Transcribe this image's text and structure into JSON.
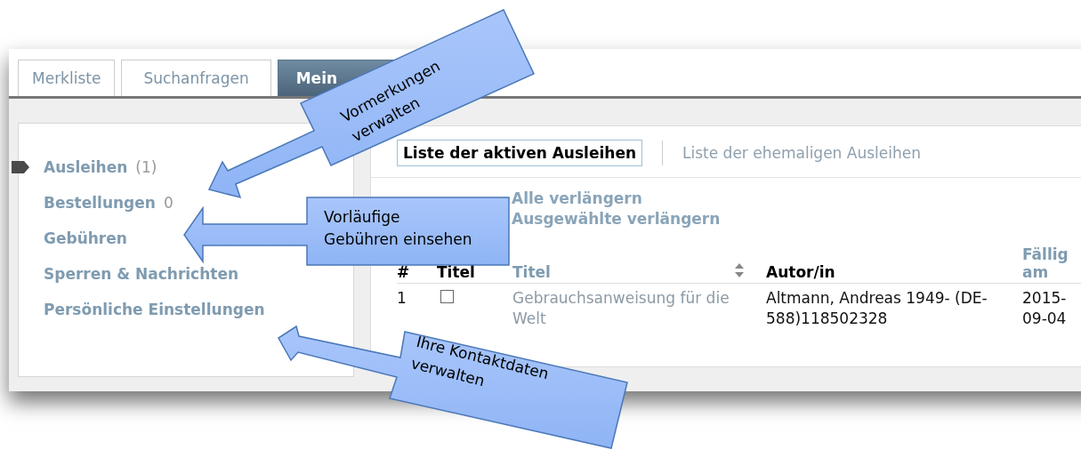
{
  "tabs": [
    {
      "label": "Merkliste",
      "selected": false
    },
    {
      "label": "Suchanfragen",
      "selected": false
    },
    {
      "label": "Mein",
      "selected": true
    }
  ],
  "sidebar": {
    "items": [
      {
        "label": "Ausleihen",
        "count": "(1)",
        "selected": true
      },
      {
        "label": "Bestellungen",
        "count": "0",
        "selected": false
      },
      {
        "label": "Gebühren",
        "selected": false
      },
      {
        "label": "Sperren & Nachrichten",
        "selected": false
      },
      {
        "label": "Persönliche Einstellungen",
        "selected": false
      }
    ]
  },
  "subtabs": [
    {
      "label": "Liste der aktiven Ausleihen",
      "selected": true
    },
    {
      "label": "Liste der ehemaligen Ausleihen",
      "selected": false
    }
  ],
  "actions": [
    "Alle verlängern",
    "Ausgewählte verlängern"
  ],
  "table": {
    "columns": [
      {
        "label": "#",
        "link": false,
        "sortable": false
      },
      {
        "label": "Titel",
        "link": false,
        "sortable": false
      },
      {
        "label": "Titel",
        "link": true,
        "sortable": true
      },
      {
        "label": "Autor/in",
        "link": false,
        "sortable": false
      },
      {
        "label": "Fällig am",
        "link": true,
        "sortable": false
      }
    ],
    "rows": [
      {
        "number": "1",
        "checked": false,
        "title": "Gebrauchsanweisung für die Welt",
        "author": "Altmann, Andreas 1949- (DE-588)118502328",
        "due": "2015-09-04"
      }
    ]
  },
  "callouts": [
    {
      "text": "Vormerkungen verwalten"
    },
    {
      "text": "Vorläufige\nGebühren einsehen"
    },
    {
      "text": "Ihre Kontaktdaten verwalten"
    }
  ]
}
